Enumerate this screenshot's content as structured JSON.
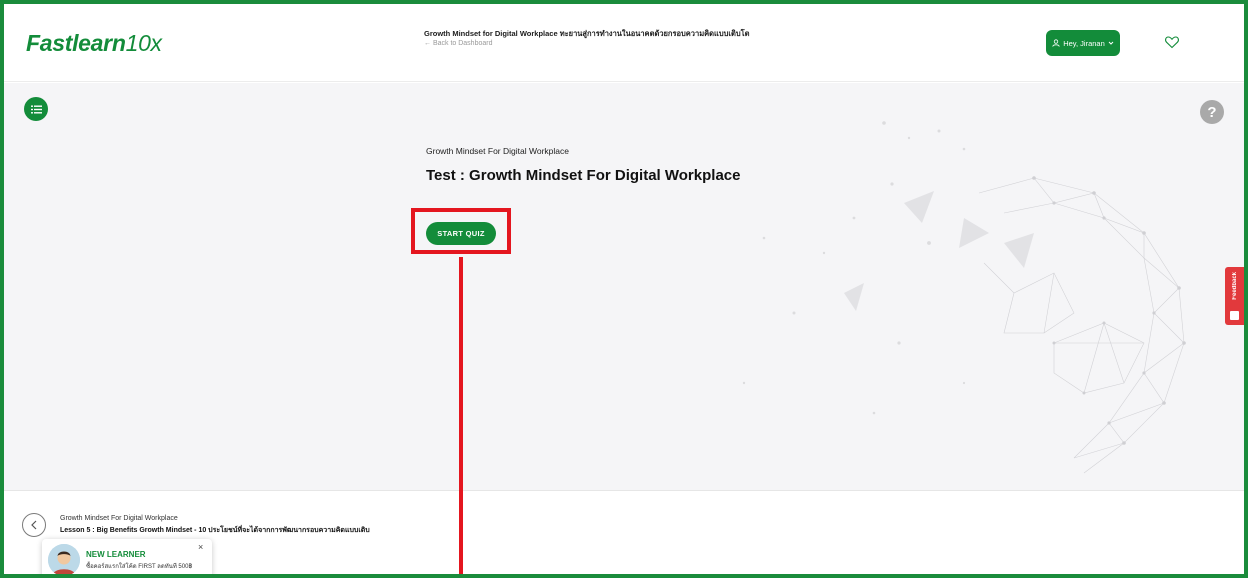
{
  "header": {
    "logo_main": "Fastlearn",
    "logo_tail": "10x",
    "course_title": "Growth Mindset for Digital Workplace ทะยานสู่การทำงานในอนาคตด้วยกรอบความคิดแบบเติบโต",
    "back_link": "← Back to Dashboard",
    "user_button": "Hey, Jiranan"
  },
  "main": {
    "subheading": "Growth Mindset For Digital Workplace",
    "quiz_title": "Test : Growth Mindset For Digital Workplace",
    "start_button": "START QUIZ",
    "help_symbol": "?",
    "feedback_label": "Feedback"
  },
  "bottom": {
    "prev_course": "Growth Mindset For Digital Workplace",
    "prev_lesson": "Lesson 5 : Big Benefits Growth Mindset - 10 ประโยชน์ที่จะได้จากการพัฒนากรอบความคิดแบบเติบ",
    "toast_title": "NEW LEARNER",
    "toast_text": "ซื้อคอร์สแรกใส่โค้ด FIRST ลดทันที 500฿",
    "toast_close": "×"
  },
  "colors": {
    "brand_green": "#138c3a",
    "frame_green": "#1a8c3c",
    "highlight_red": "#e4161f",
    "feedback_red": "#e2393c"
  },
  "icons": [
    "menu-list-icon",
    "user-icon",
    "chevron-down-icon",
    "heart-icon",
    "help-icon",
    "chevron-left-icon",
    "close-icon",
    "feedback-icon"
  ]
}
